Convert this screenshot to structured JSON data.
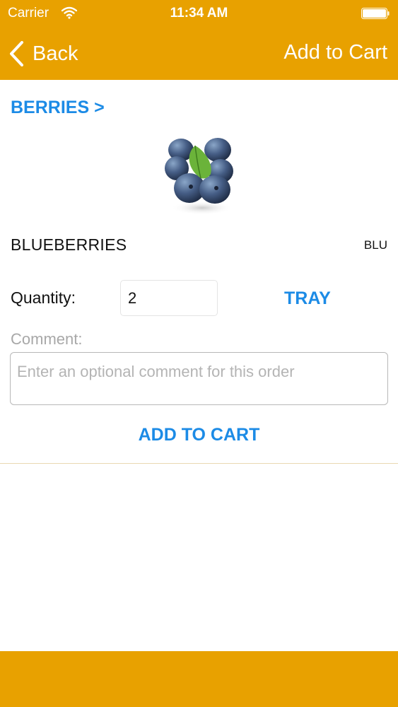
{
  "status_bar": {
    "carrier": "Carrier",
    "time": "11:34 AM",
    "wifi_icon": "wifi-icon",
    "battery_icon": "battery-icon"
  },
  "nav": {
    "back_label": "Back",
    "back_icon": "chevron-left-icon",
    "right_action": "Add to Cart"
  },
  "category_link": "BERRIES >",
  "product": {
    "image": "blueberries-photo",
    "name": "BLUEBERRIES",
    "code": "BLU"
  },
  "quantity": {
    "label": "Quantity:",
    "value": "2",
    "unit_button": "TRAY"
  },
  "comment": {
    "label": "Comment:",
    "placeholder": "Enter an optional comment for this order",
    "value": ""
  },
  "add_to_cart_button": "ADD TO CART",
  "colors": {
    "brand_orange": "#e8a100",
    "link_blue": "#1c8be6"
  }
}
